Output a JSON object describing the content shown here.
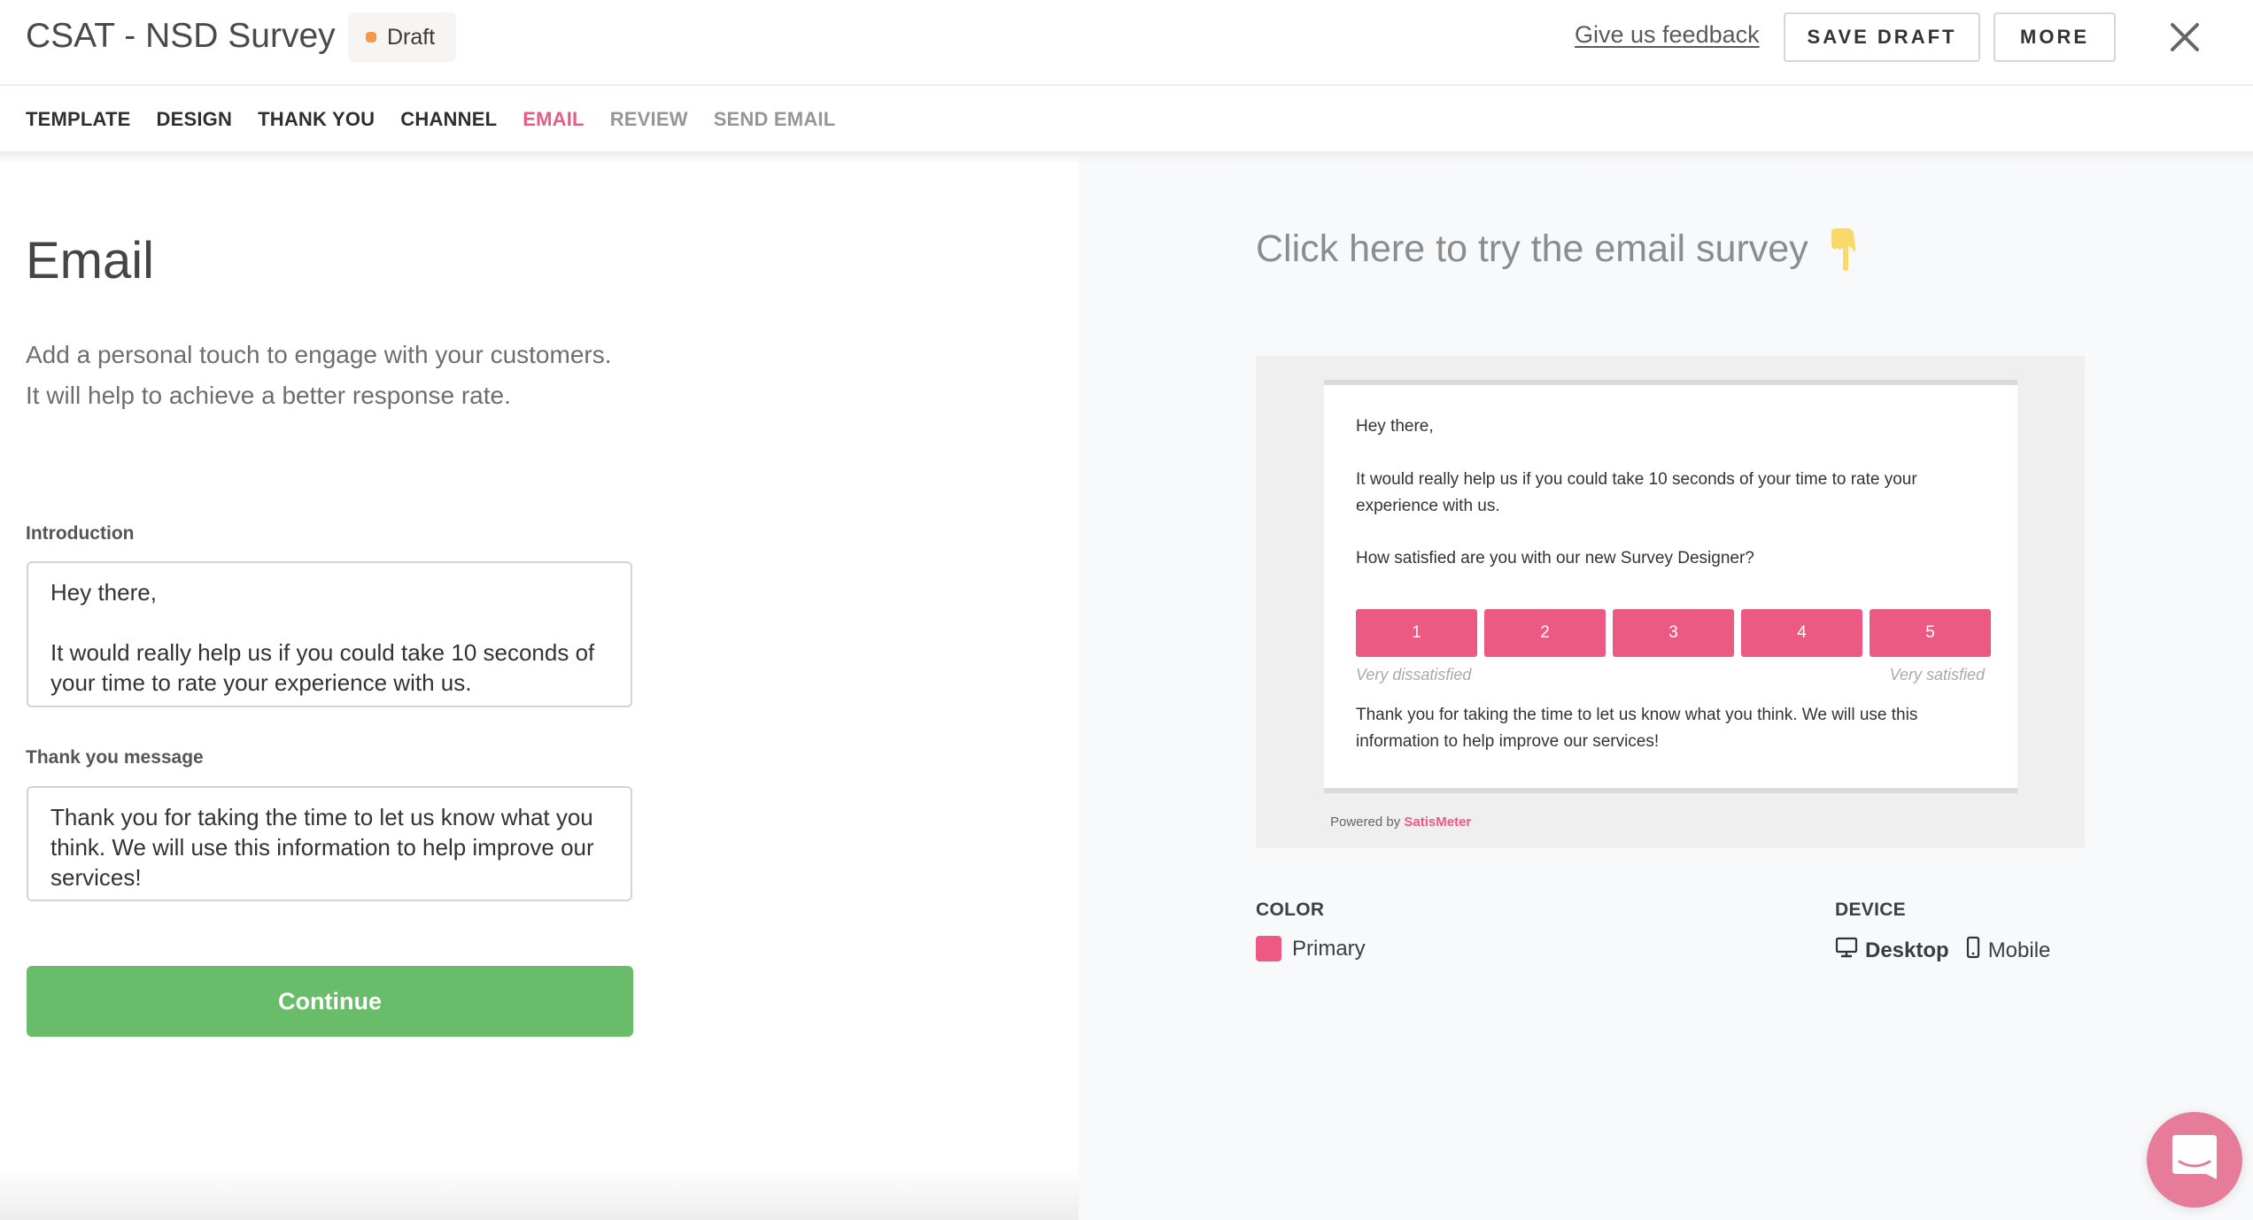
{
  "header": {
    "title": "CSAT - NSD Survey",
    "status_badge": "Draft",
    "status_color": "#f0994a",
    "feedback_link": "Give us feedback",
    "save_draft_label": "SAVE DRAFT",
    "more_label": "MORE",
    "close_icon": "close-icon"
  },
  "tabs": [
    {
      "label": "TEMPLATE",
      "state": "done"
    },
    {
      "label": "DESIGN",
      "state": "done"
    },
    {
      "label": "THANK YOU",
      "state": "done"
    },
    {
      "label": "CHANNEL",
      "state": "done"
    },
    {
      "label": "EMAIL",
      "state": "active"
    },
    {
      "label": "REVIEW",
      "state": "pending"
    },
    {
      "label": "SEND EMAIL",
      "state": "pending"
    }
  ],
  "left": {
    "title": "Email",
    "description": "Add a personal touch to engage with your customers. It will help to achieve a better response rate.",
    "introduction_label": "Introduction",
    "introduction_value": "Hey there,\n\nIt would really help us if you could take 10 seconds of your time to rate your experience with us.",
    "thankyou_label": "Thank you message",
    "thankyou_value": "Thank you for taking the time to let us know what you think. We will use this information to help improve our services!",
    "continue_label": "Continue"
  },
  "preview": {
    "try_link": "Click here to try the email survey",
    "try_icon": "pointing-down-icon",
    "greeting": "Hey there,",
    "intro": "It would really help us if you could take 10 seconds of your time to rate your experience with us.",
    "question": "How satisfied are you with our new Survey Designer?",
    "ratings": [
      "1",
      "2",
      "3",
      "4",
      "5"
    ],
    "scale_low": "Very dissatisfied",
    "scale_high": "Very satisfied",
    "thanks": "Thank you for taking the time to let us know what you think. We will use this information to help improve our services!",
    "powered_by": "Powered by",
    "brand": "SatisMeter"
  },
  "options": {
    "color_label": "COLOR",
    "color_name": "Primary",
    "color_value": "#ec5a84",
    "device_label": "DEVICE",
    "devices": [
      {
        "label": "Desktop",
        "icon": "desktop-icon",
        "selected": true
      },
      {
        "label": "Mobile",
        "icon": "mobile-icon",
        "selected": false
      }
    ]
  },
  "chat_widget": {
    "icon": "chat-icon"
  },
  "colors": {
    "accent": "#ec5a84",
    "continue": "#69bd6a"
  }
}
